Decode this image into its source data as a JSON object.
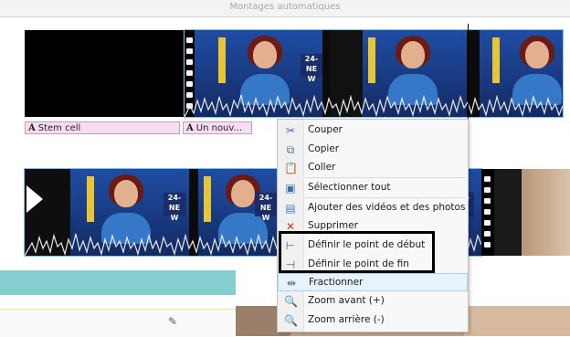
{
  "header": {
    "title": "Montages automatiques"
  },
  "captions": [
    {
      "label": "Stem cell"
    },
    {
      "label": "Un nouv..."
    }
  ],
  "thumbnails": {
    "logo_text": "24-\nNE\nW"
  },
  "context_menu": {
    "items": [
      {
        "label": "Couper",
        "icon": "scissors-icon"
      },
      {
        "label": "Copier",
        "icon": "copy-icon"
      },
      {
        "label": "Coller",
        "icon": "paste-icon"
      },
      {
        "label": "Sélectionner tout",
        "icon": "select-all-icon"
      },
      {
        "label": "Ajouter des vidéos et des photos",
        "icon": "add-media-icon"
      },
      {
        "label": "Supprimer",
        "icon": "delete-icon"
      },
      {
        "label": "Définir le point de début",
        "icon": "set-start-icon"
      },
      {
        "label": "Définir le point de fin",
        "icon": "set-end-icon"
      },
      {
        "label": "Fractionner",
        "icon": "split-icon"
      },
      {
        "label": "Zoom avant (+)",
        "icon": "zoom-in-icon"
      },
      {
        "label": "Zoom arrière (-)",
        "icon": "zoom-out-icon"
      }
    ]
  },
  "colors": {
    "selection_outline": "#7fc4e8",
    "caption_bg": "#f8dcf3",
    "teal_bar": "#86cfd0",
    "delete_red": "#d0312d",
    "highlight_bg": "#e6f3fd"
  }
}
